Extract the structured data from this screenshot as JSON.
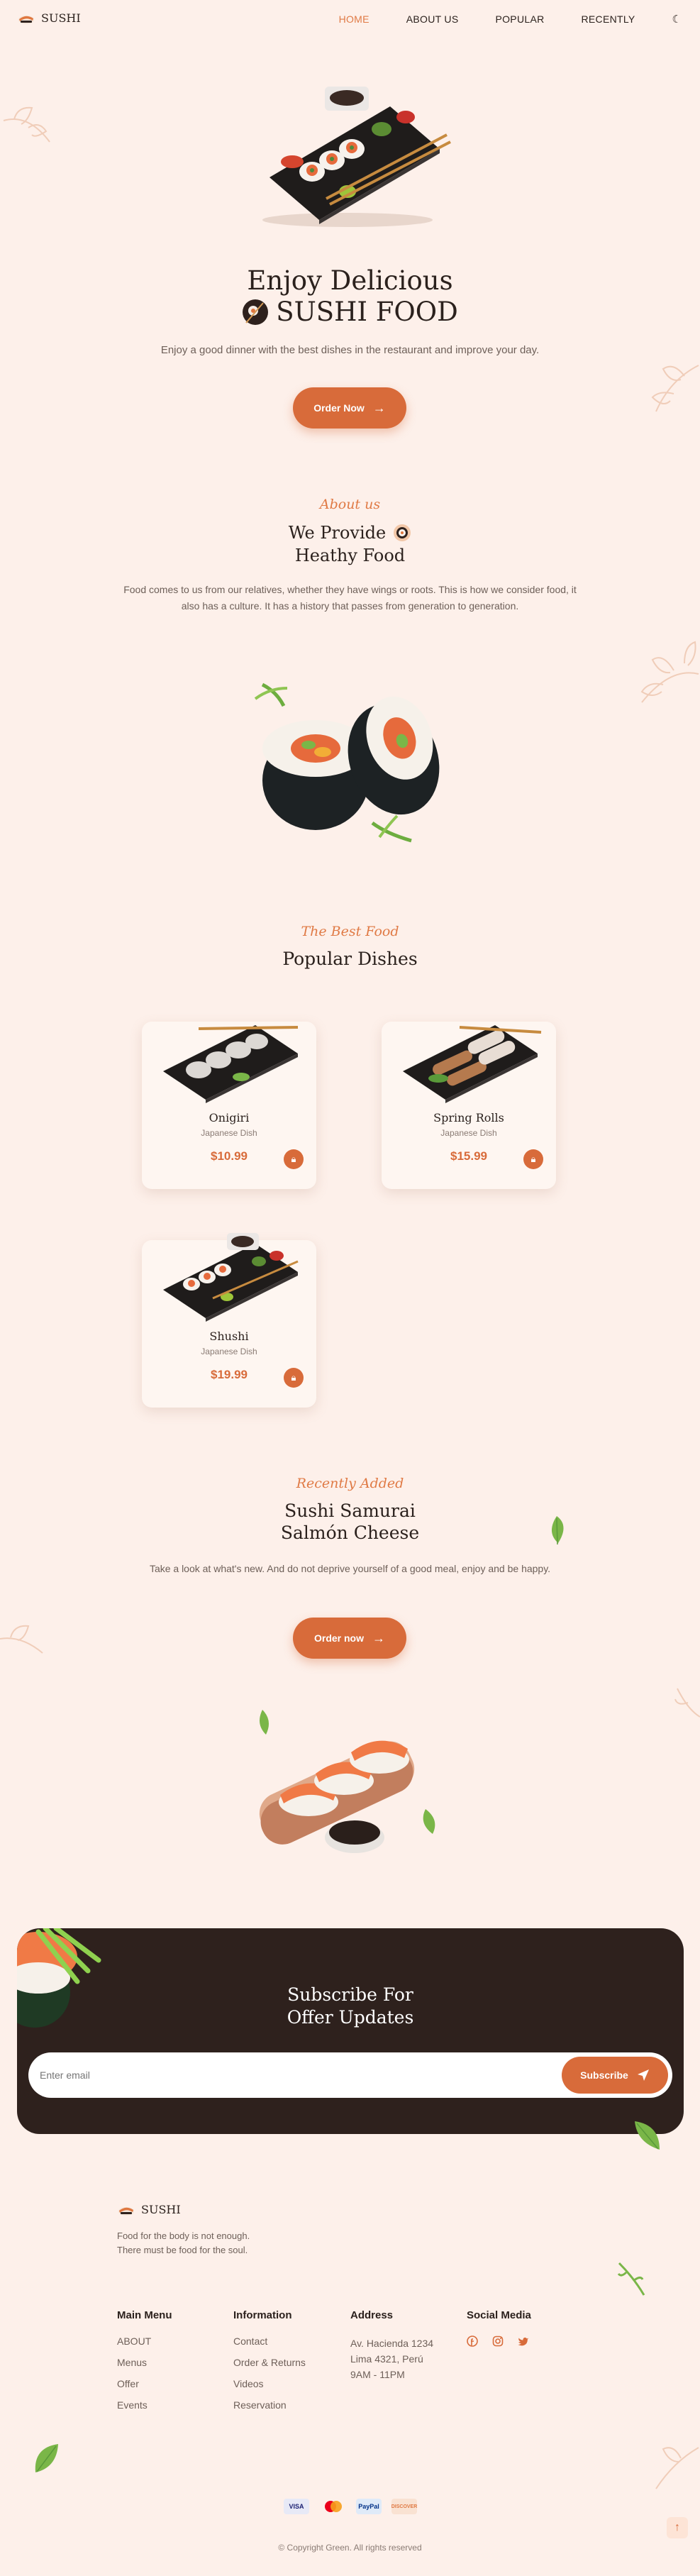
{
  "header": {
    "brand": "SUSHI",
    "nav": [
      "HOME",
      "ABOUT US",
      "POPULAR",
      "RECENTLY"
    ],
    "active_nav": "HOME"
  },
  "hero": {
    "title_line1": "Enjoy Delicious",
    "title_line2": "SUSHI FOOD",
    "description": "Enjoy a good dinner with the best dishes in the restaurant and improve your day.",
    "button": "Order Now"
  },
  "about": {
    "kicker": "About us",
    "title_line1": "We Provide",
    "title_line2": "Heathy Food",
    "description": "Food comes to us from our relatives, whether they have wings or roots. This is how we consider food, it also has a culture. It has a history that passes from generation to generation."
  },
  "popular": {
    "kicker": "The Best Food",
    "title": "Popular Dishes",
    "items": [
      {
        "name": "Onigiri",
        "type": "Japanese Dish",
        "price": "$10.99"
      },
      {
        "name": "Spring Rolls",
        "type": "Japanese Dish",
        "price": "$15.99"
      },
      {
        "name": "Shushi",
        "type": "Japanese Dish",
        "price": "$19.99"
      }
    ]
  },
  "recent": {
    "kicker": "Recently Added",
    "title_line1": "Sushi Samurai",
    "title_line2": "Salmón Cheese",
    "description": "Take a look at what's new. And do not deprive yourself of a good meal, enjoy and be happy.",
    "button": "Order now"
  },
  "newsletter": {
    "title_line1": "Subscribe For",
    "title_line2": "Offer Updates",
    "placeholder": "Enter email",
    "button": "Subscribe"
  },
  "footer": {
    "brand": "SUSHI",
    "tagline": "Food for the body is not enough. There must be food for the soul.",
    "columns": [
      {
        "title": "Main Menu",
        "links": [
          "ABOUT",
          "Menus",
          "Offer",
          "Events"
        ]
      },
      {
        "title": "Information",
        "links": [
          "Contact",
          "Order & Returns",
          "Videos",
          "Reservation"
        ]
      },
      {
        "title": "Address",
        "links": [
          "Av. Hacienda 1234",
          "Lima 4321, Perú",
          "9AM - 11PM"
        ]
      }
    ],
    "social_title": "Social Media",
    "payments": [
      "VISA",
      "mastercard",
      "PayPal",
      "DISCOVER"
    ],
    "copyright": "© Copyright Green. All rights reserved"
  },
  "colors": {
    "accent": "#d86b3a",
    "background": "#fdf0ea",
    "dark": "#2e211d"
  }
}
